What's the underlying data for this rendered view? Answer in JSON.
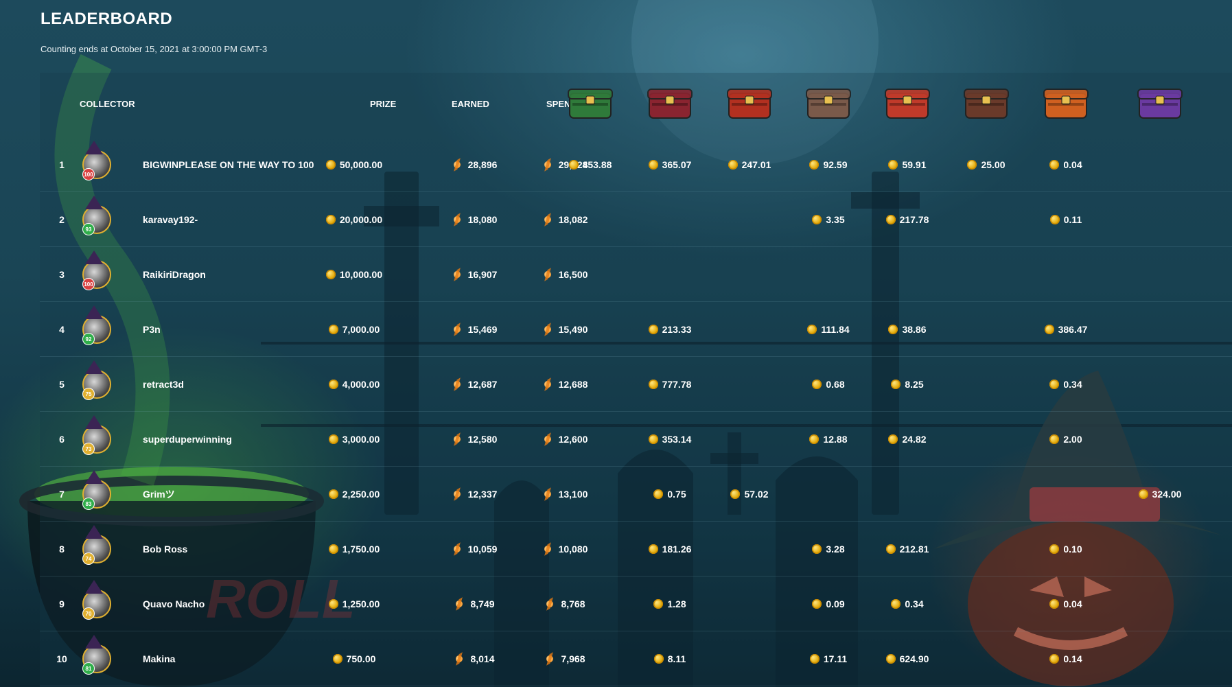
{
  "header": {
    "title": "LEADERBOARD",
    "subtitle": "Counting ends at October 15, 2021 at 3:00:00 PM GMT-3"
  },
  "columns": {
    "collector": "COLLECTOR",
    "prize": "PRIZE",
    "earned": "EARNED",
    "spent": "SPENT"
  },
  "case_icons": [
    {
      "name": "case-1-icon",
      "color": "#2f7a3a"
    },
    {
      "name": "case-2-icon",
      "color": "#8a2430"
    },
    {
      "name": "case-3-icon",
      "color": "#b23020"
    },
    {
      "name": "case-4-icon",
      "color": "#7a5a4a"
    },
    {
      "name": "case-5-icon",
      "color": "#c03a2a"
    },
    {
      "name": "case-6-icon",
      "color": "#6a3a2a"
    },
    {
      "name": "case-7-icon",
      "color": "#d06020"
    },
    {
      "name": "case-8-icon",
      "color": "#6a3aa0"
    }
  ],
  "rows": [
    {
      "rank": "1",
      "name": "BIGWINPLEASE ON THE WAY TO 100",
      "level": "100",
      "level_color": "#d94040",
      "prize": "50,000.00",
      "earned": "28,896",
      "spent": "29,428",
      "cases": [
        "453.88",
        "365.07",
        "247.01",
        "92.59",
        "59.91",
        "25.00",
        "0.04",
        ""
      ]
    },
    {
      "rank": "2",
      "name": "karavay192-",
      "level": "93",
      "level_color": "#2fae4a",
      "prize": "20,000.00",
      "earned": "18,080",
      "spent": "18,082",
      "cases": [
        "",
        "",
        "",
        "3.35",
        "217.78",
        "",
        "0.11",
        ""
      ]
    },
    {
      "rank": "3",
      "name": "RaikiriDragon",
      "level": "100",
      "level_color": "#d94040",
      "prize": "10,000.00",
      "earned": "16,907",
      "spent": "16,500",
      "cases": [
        "",
        "",
        "",
        "",
        "",
        "",
        "",
        ""
      ]
    },
    {
      "rank": "4",
      "name": "P3n",
      "level": "92",
      "level_color": "#2fae4a",
      "prize": "7,000.00",
      "earned": "15,469",
      "spent": "15,490",
      "cases": [
        "",
        "213.33",
        "",
        "111.84",
        "38.86",
        "",
        "386.47",
        ""
      ]
    },
    {
      "rank": "5",
      "name": "retract3d",
      "level": "75",
      "level_color": "#e0b030",
      "prize": "4,000.00",
      "earned": "12,687",
      "spent": "12,688",
      "cases": [
        "",
        "777.78",
        "",
        "0.68",
        "8.25",
        "",
        "0.34",
        ""
      ]
    },
    {
      "rank": "6",
      "name": "superduperwinning",
      "level": "73",
      "level_color": "#e0b030",
      "prize": "3,000.00",
      "earned": "12,580",
      "spent": "12,600",
      "cases": [
        "",
        "353.14",
        "",
        "12.88",
        "24.82",
        "",
        "2.00",
        ""
      ]
    },
    {
      "rank": "7",
      "name": "Grimツ",
      "level": "83",
      "level_color": "#2fae4a",
      "prize": "2,250.00",
      "earned": "12,337",
      "spent": "13,100",
      "cases": [
        "",
        "0.75",
        "57.02",
        "",
        "",
        "",
        "",
        "324.00"
      ]
    },
    {
      "rank": "8",
      "name": "Bob Ross",
      "level": "74",
      "level_color": "#e0b030",
      "prize": "1,750.00",
      "earned": "10,059",
      "spent": "10,080",
      "cases": [
        "",
        "181.26",
        "",
        "3.28",
        "212.81",
        "",
        "0.10",
        ""
      ]
    },
    {
      "rank": "9",
      "name": "Quavo Nacho",
      "level": "70",
      "level_color": "#e0b030",
      "prize": "1,250.00",
      "earned": "8,749",
      "spent": "8,768",
      "cases": [
        "",
        "1.28",
        "",
        "0.09",
        "0.34",
        "",
        "0.04",
        ""
      ]
    },
    {
      "rank": "10",
      "name": "Makina",
      "level": "81",
      "level_color": "#2fae4a",
      "prize": "750.00",
      "earned": "8,014",
      "spent": "7,968",
      "cases": [
        "",
        "8.11",
        "",
        "17.11",
        "624.90",
        "",
        "0.14",
        ""
      ]
    }
  ]
}
